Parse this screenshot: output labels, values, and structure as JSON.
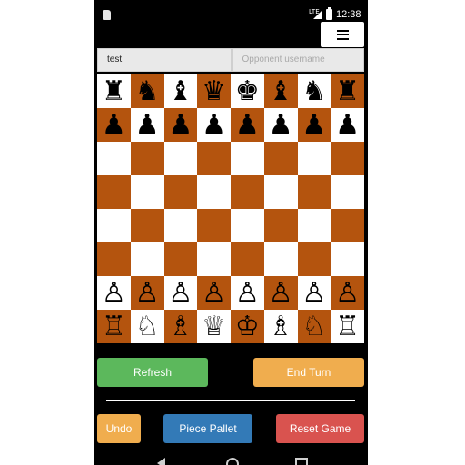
{
  "status_bar": {
    "lte_label": "LTE",
    "time": "12:38"
  },
  "players": {
    "player_name": "test",
    "opponent_placeholder": "Opponent username"
  },
  "board": {
    "rows": [
      [
        "♜",
        "♞",
        "♝",
        "♛",
        "♚",
        "♝",
        "♞",
        "♜"
      ],
      [
        "♟",
        "♟",
        "♟",
        "♟",
        "♟",
        "♟",
        "♟",
        "♟"
      ],
      [
        "",
        "",
        "",
        "",
        "",
        "",
        "",
        ""
      ],
      [
        "",
        "",
        "",
        "",
        "",
        "",
        "",
        ""
      ],
      [
        "",
        "",
        "",
        "",
        "",
        "",
        "",
        ""
      ],
      [
        "",
        "",
        "",
        "",
        "",
        "",
        "",
        ""
      ],
      [
        "♙",
        "♙",
        "♙",
        "♙",
        "♙",
        "♙",
        "♙",
        "♙"
      ],
      [
        "♖",
        "♘",
        "♗",
        "♕",
        "♔",
        "♗",
        "♘",
        "♖"
      ]
    ],
    "light_color": "#ffffff",
    "dark_color": "#b4540e"
  },
  "buttons": {
    "refresh": "Refresh",
    "end_turn": "End Turn",
    "undo": "Undo",
    "piece_pallet": "Piece Pallet",
    "reset_game": "Reset Game"
  },
  "colors": {
    "success": "#5cb85c",
    "warning": "#f0ad4e",
    "primary": "#337ab7",
    "danger": "#d9534f"
  },
  "icons": {
    "menu": "hamburger-menu-icon",
    "sd": "sd-card-icon",
    "signal": "signal-icon",
    "battery": "battery-icon"
  }
}
